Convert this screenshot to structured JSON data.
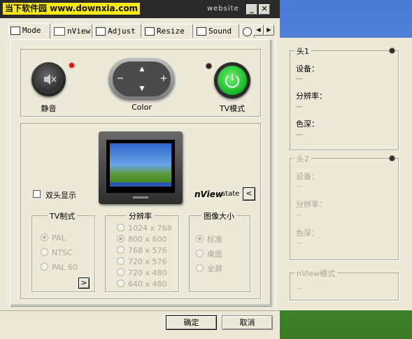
{
  "watermark": {
    "text": "当下软件园 www.downxia.com"
  },
  "window": {
    "title": "website",
    "minimize": "_",
    "close": "✕"
  },
  "tabs": [
    {
      "label": "Mode"
    },
    {
      "label": "nView"
    },
    {
      "label": "Adjust"
    },
    {
      "label": "Resize"
    },
    {
      "label": "Sound"
    }
  ],
  "controls": {
    "mute_label": "静音",
    "color_label": "Color",
    "tv_label": "TV模式",
    "up": "▲",
    "down": "▼",
    "minus": "−",
    "plus": "+"
  },
  "display": {
    "dual_label": "双头显示",
    "nview_brand": "nView",
    "nview_state": "state",
    "state_arrow": "<",
    "tv_standard": {
      "title": "TV制式",
      "options": [
        "PAL",
        "NTSC",
        "PAL 60"
      ],
      "selected": "PAL",
      "more": ">"
    },
    "resolution": {
      "title": "分辨率",
      "options": [
        "1024 x 768",
        "800 x 600",
        "768 x 576",
        "720 x 576",
        "720 x 480",
        "640 x 480"
      ],
      "selected": "800 x 600"
    },
    "image_size": {
      "title": "图像大小",
      "options": [
        "标准",
        "桌面",
        "全屏"
      ],
      "selected": "标准"
    }
  },
  "buttons": {
    "ok": "确定",
    "cancel": "取消"
  },
  "right_panel": {
    "head1": {
      "title": "头1",
      "device_label": "设备：",
      "device_value": "---",
      "res_label": "分辨率：",
      "res_value": "---",
      "color_label": "色深：",
      "color_value": "---"
    },
    "head2": {
      "title": "头2",
      "device_label": "设备：",
      "device_value": "---",
      "res_label": "分辨率：",
      "res_value": "---",
      "color_label": "色深：",
      "color_value": "---"
    },
    "nview_mode": {
      "title": "nView模式",
      "value": "---"
    }
  }
}
